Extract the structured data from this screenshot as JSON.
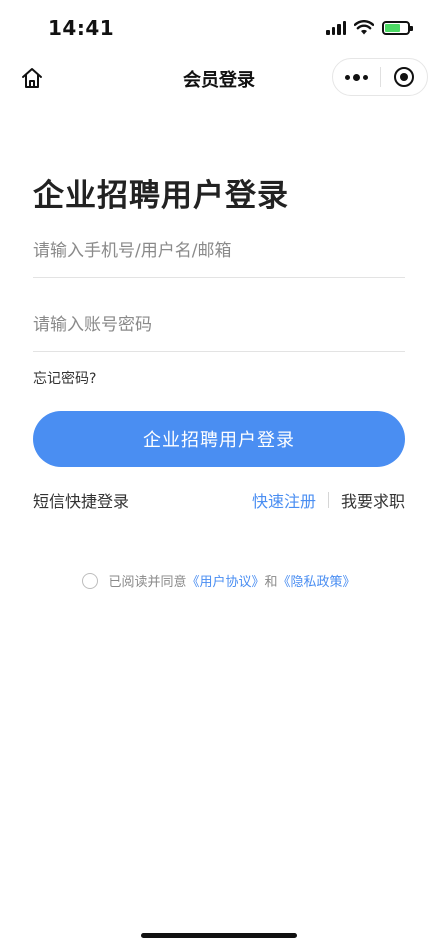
{
  "status_bar": {
    "time": "14:41",
    "icons": [
      "signal-icon",
      "wifi-icon",
      "battery-charging-icon"
    ],
    "battery_color": "#4cd964"
  },
  "nav": {
    "title": "会员登录",
    "left_icon": "home-icon",
    "capsule_icons": [
      "more-icon",
      "close-target-icon"
    ]
  },
  "login": {
    "title": "企业招聘用户登录",
    "username_placeholder": "请输入手机号/用户名/邮箱",
    "password_placeholder": "请输入账号密码",
    "forgot_label": "忘记密码?",
    "submit_label": "企业招聘用户登录",
    "sms_login_label": "短信快捷登录",
    "register_label": "快速注册",
    "jobseeker_label": "我要求职"
  },
  "agreement": {
    "prefix": "已阅读并同意",
    "user_agreement": "《用户协议》",
    "conjunction": "和",
    "privacy_policy": "《隐私政策》"
  },
  "colors": {
    "accent": "#4a8ef2",
    "text": "#222222",
    "placeholder": "#8a8a8a"
  }
}
